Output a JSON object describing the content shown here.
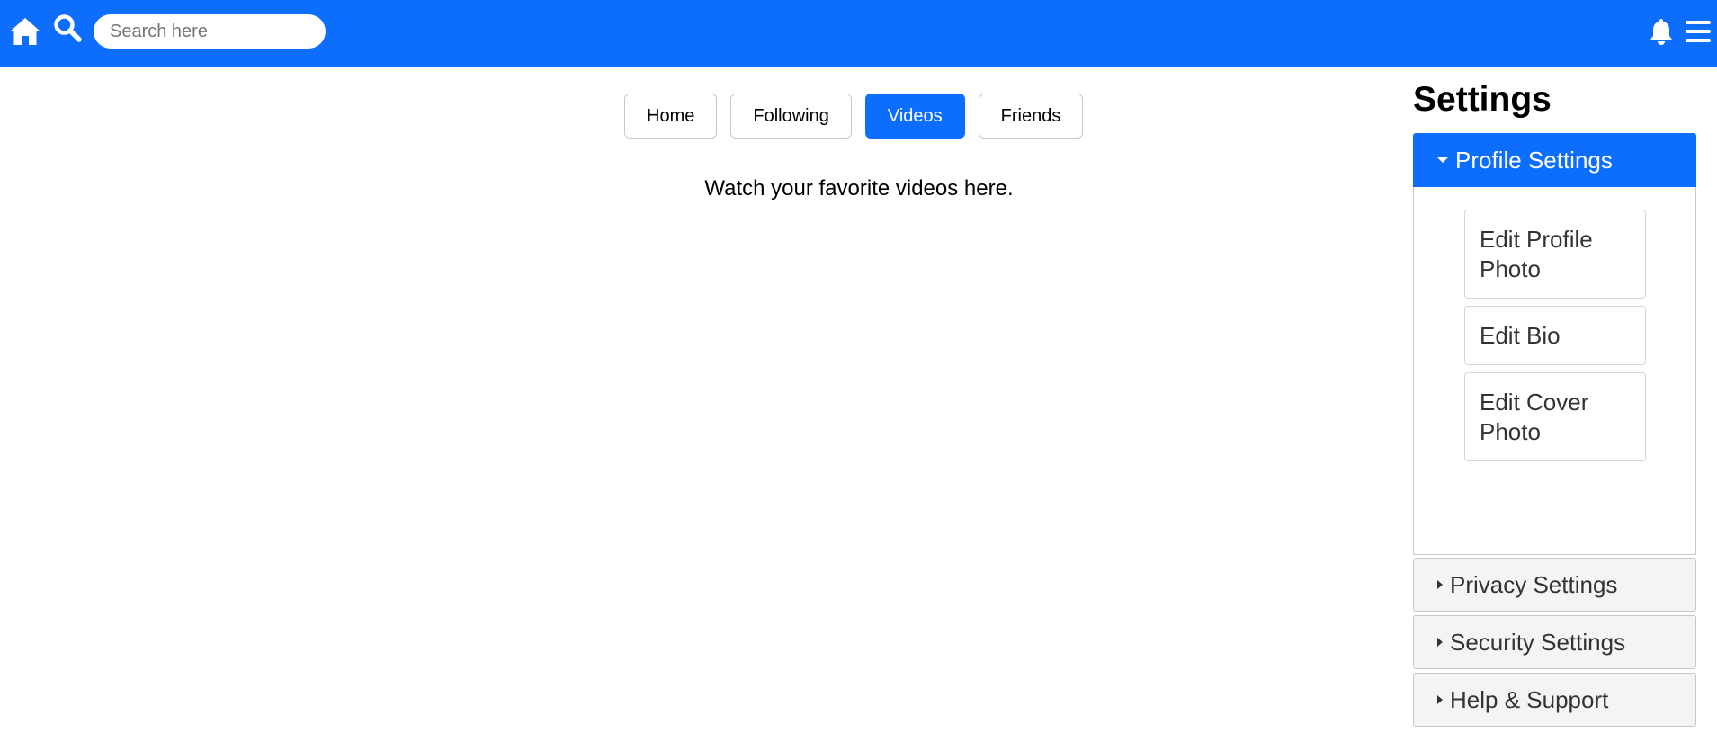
{
  "topbar": {
    "home_icon": "home-icon",
    "search_icon": "search-icon",
    "search_placeholder": "Search here",
    "bell_icon": "bell-icon",
    "menu_icon": "hamburger-menu-icon",
    "accent_color": "#0d6efd"
  },
  "tabs": [
    {
      "label": "Home",
      "active": false
    },
    {
      "label": "Following",
      "active": false
    },
    {
      "label": "Videos",
      "active": true
    },
    {
      "label": "Friends",
      "active": false
    }
  ],
  "content": {
    "text": "Watch your favorite videos here."
  },
  "settings": {
    "title": "Settings",
    "sections": [
      {
        "label": "Profile Settings",
        "open": true,
        "items": [
          "Edit Profile Photo",
          "Edit Bio",
          "Edit Cover Photo"
        ]
      },
      {
        "label": "Privacy Settings",
        "open": false
      },
      {
        "label": "Security Settings",
        "open": false
      },
      {
        "label": "Help & Support",
        "open": false
      }
    ]
  }
}
